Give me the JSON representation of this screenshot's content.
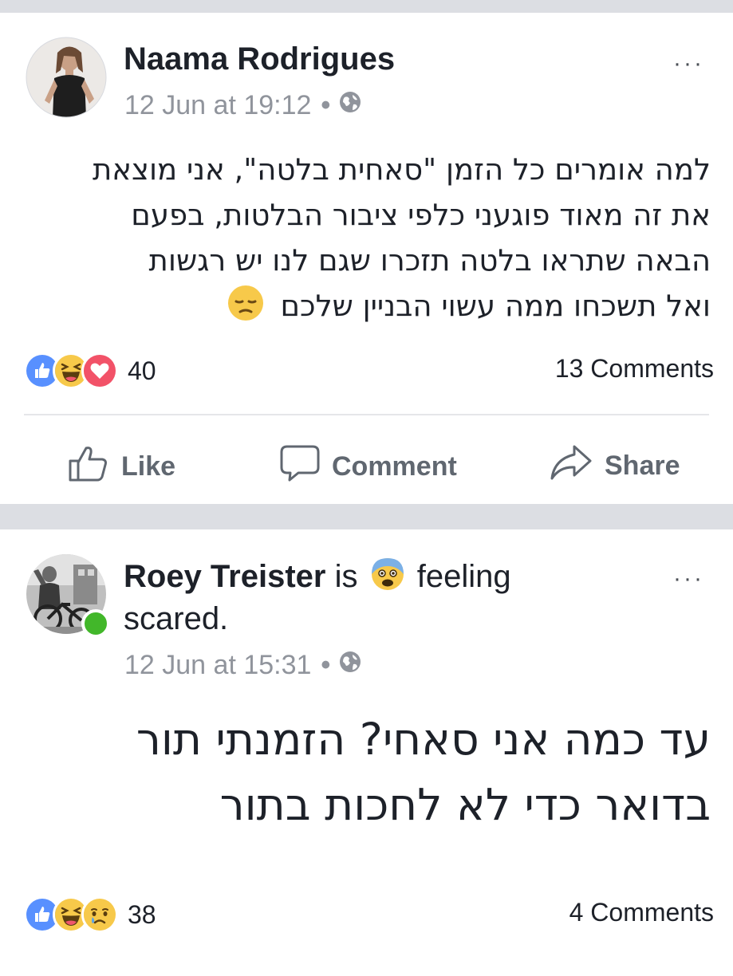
{
  "posts": [
    {
      "author": "Naama Rodrigues",
      "timestamp": "12 Jun at 19:12",
      "privacy_icon": "globe-icon",
      "more_label": "···",
      "body_lines": [
        "למה אומרים כל הזמן \"סאחית בלטה\", אני מוצאת",
        "את זה מאוד פוגעני כלפי ציבור הבלטות, בפעם",
        "הבאה שתראו בלטה תזכרו שגם לנו יש רגשות",
        "ואל תשכחו ממה עשוי הבניין שלכם"
      ],
      "body_emoji": "disappointed-face-icon",
      "reactions": [
        "like-icon",
        "haha-icon",
        "love-icon"
      ],
      "reaction_count": "40",
      "comments": "13 Comments",
      "actions": {
        "like": "Like",
        "comment": "Comment",
        "share": "Share"
      }
    },
    {
      "author": "Roey Treister",
      "feeling_prefix": "is",
      "feeling_emoji": "fearful-face-icon",
      "feeling_line1": "feeling",
      "feeling_line2": "scared.",
      "timestamp": "12 Jun at 15:31",
      "privacy_icon": "globe-icon",
      "more_label": "···",
      "online": true,
      "body_lines": [
        "עד כמה אני סאחי? הזמנתי תור",
        "בדואר כדי לא לחכות בתור"
      ],
      "reactions": [
        "like-icon",
        "haha-icon",
        "sad-icon"
      ],
      "reaction_count": "38",
      "comments": "4 Comments"
    }
  ],
  "colors": {
    "link_blue": "#5890ff",
    "love_red": "#f25268",
    "emoji_yellow": "#f7c94a",
    "online_green": "#42b72a",
    "meta_gray": "#90949c"
  }
}
